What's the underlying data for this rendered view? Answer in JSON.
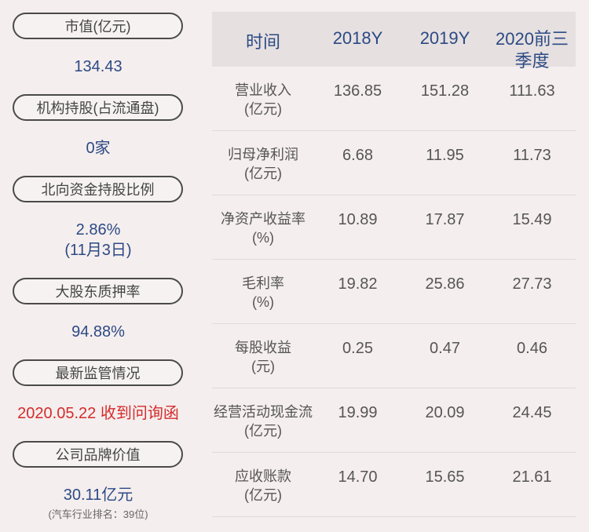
{
  "left": [
    {
      "label": "市值(亿元)",
      "value": "134.43"
    },
    {
      "label": "机构持股(占流通盘)",
      "value": "0家"
    },
    {
      "label": "北向资金持股比例",
      "value": "2.86%",
      "value2": "(11月3日)"
    },
    {
      "label": "大股东质押率",
      "value": "94.88%"
    },
    {
      "label": "最新监管情况",
      "value": "2020.05.22 收到问询函"
    },
    {
      "label": "公司品牌价值",
      "value": "30.11亿元",
      "note": "(汽车行业排名：39位)"
    }
  ],
  "table": {
    "headers": [
      "时间",
      "2018Y",
      "2019Y",
      "2020前三季度"
    ],
    "rows": [
      {
        "label": "营业收入",
        "unit": "(亿元)",
        "values": [
          "136.85",
          "151.28",
          "111.63"
        ]
      },
      {
        "label": "归母净利润",
        "unit": "(亿元)",
        "values": [
          "6.68",
          "11.95",
          "11.73"
        ]
      },
      {
        "label": "净资产收益率",
        "unit": "(%)",
        "values": [
          "10.89",
          "17.87",
          "15.49"
        ]
      },
      {
        "label": "毛利率",
        "unit": "(%)",
        "values": [
          "19.82",
          "25.86",
          "27.73"
        ]
      },
      {
        "label": "每股收益",
        "unit": "(元)",
        "values": [
          "0.25",
          "0.47",
          "0.46"
        ]
      },
      {
        "label": "经营活动现金流",
        "unit": "(亿元)",
        "values": [
          "19.99",
          "20.09",
          "24.45"
        ]
      },
      {
        "label": "应收账款",
        "unit": "(亿元)",
        "values": [
          "14.70",
          "15.65",
          "21.61"
        ]
      }
    ]
  },
  "colors": {
    "accent": "#2c4a84",
    "alert": "#d42b2b",
    "background": "#f5eeee",
    "header_bg": "#e6e0e0"
  }
}
